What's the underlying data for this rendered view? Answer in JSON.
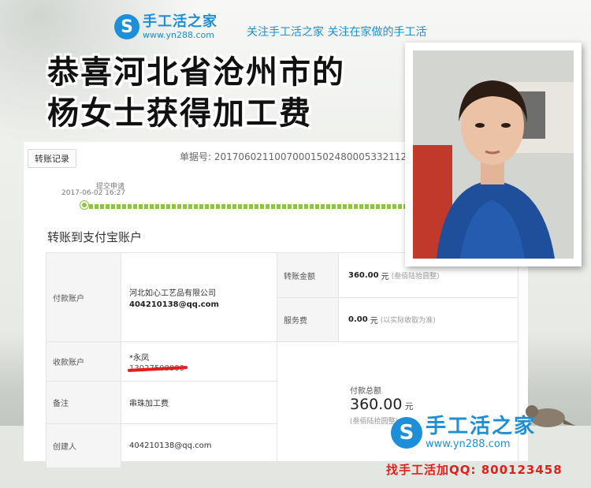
{
  "brand": {
    "logo_name": "手工活之家",
    "logo_url": "www.yn288.com",
    "slogan": "关注手工活之家  关注在家做的手工活"
  },
  "headline": {
    "line1": "恭喜河北省沧州市的",
    "line2": "杨女士获得加工费"
  },
  "receipt": {
    "tab": "转账记录",
    "order_no": "单据号: 20170602110070001502480005332112",
    "step_label": "提交申请",
    "step_time": "2017-06-02 16:27",
    "section_title": "转账到支付宝账户",
    "payer_label": "付款账户",
    "payer_company": "河北如心工艺品有限公司",
    "payer_email": "404210138@qq.com",
    "amount_label": "转账金额",
    "amount_value": "360.00",
    "amount_unit": "元",
    "amount_words": "(叁佰陆拾圆整)",
    "fee_label": "服务费",
    "fee_value": "0.00",
    "fee_unit": "元",
    "fee_note": "(以实际收取为准)",
    "payee_label": "收款账户",
    "payee_name": "*永凤",
    "payee_account": "13027500000",
    "remark_label": "备注",
    "remark_value": "串珠加工费",
    "creator_label": "创建人",
    "creator_value": "404210138@qq.com",
    "total_label": "付款总额",
    "total_value": "360.00",
    "total_unit": "元",
    "total_words": "(叁佰陆拾圆整)"
  },
  "watermark": {
    "name": "手工活之家",
    "url": "www.yn288.com",
    "qq": "找手工活加QQ: 800123458"
  },
  "colors": {
    "brand_blue": "#1c8fd8",
    "progress_green": "#8cc63f",
    "alert_red": "#e0201a"
  }
}
